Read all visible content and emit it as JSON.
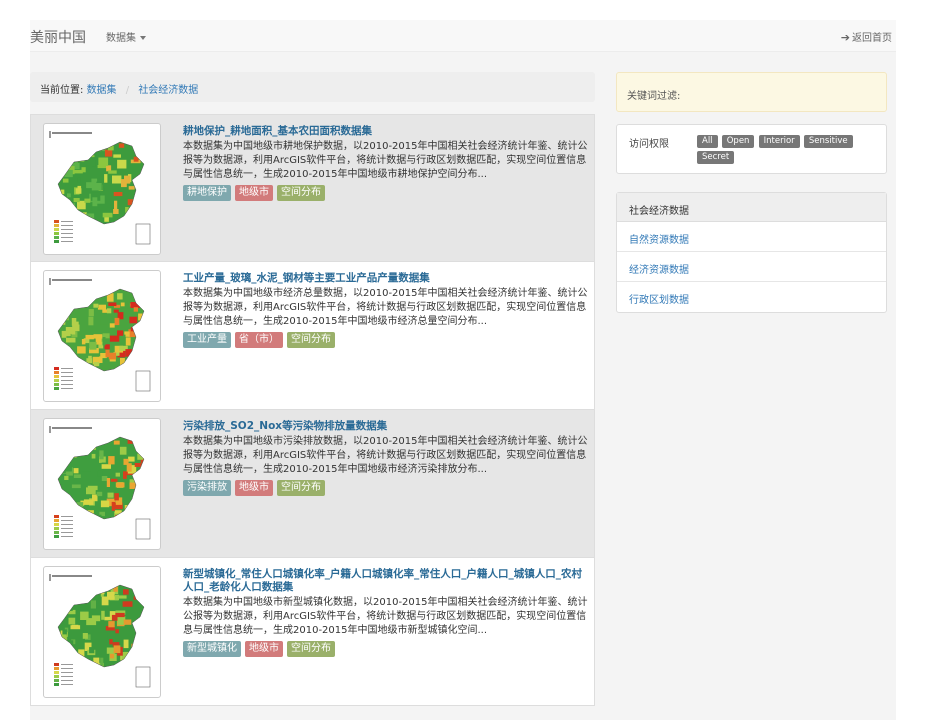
{
  "navbar": {
    "brand": "美丽中国",
    "dropdown_label": "数据集",
    "home_label": "返回首页"
  },
  "breadcrumb": {
    "prefix": "当前位置:",
    "items": [
      "数据集",
      "社会经济数据"
    ]
  },
  "datasets": [
    {
      "title": "耕地保护_耕地面积_基本农田面积数据集",
      "description": "本数据集为中国地级市耕地保护数据，以2010-2015年中国相关社会经济统计年鉴、统计公报等为数据源，利用ArcGIS软件平台，将统计数据与行政区划数据匹配，实现空间位置信息与属性信息统一，生成2010-2015年中国地级市耕地保护空间分布...",
      "tags": [
        "耕地保护",
        "地级市",
        "空间分布"
      ]
    },
    {
      "title": "工业产量_玻璃_水泥_钢材等主要工业产品产量数据集",
      "description": "本数据集为中国地级市经济总量数据，以2010-2015年中国相关社会经济统计年鉴、统计公报等为数据源，利用ArcGIS软件平台，将统计数据与行政区划数据匹配，实现空间位置信息与属性信息统一，生成2010-2015年中国地级市经济总量空间分布...",
      "tags": [
        "工业产量",
        "省（市）",
        "空间分布"
      ]
    },
    {
      "title": "污染排放_SO2_Nox等污染物排放量数据集",
      "description": "本数据集为中国地级市污染排放数据，以2010-2015年中国相关社会经济统计年鉴、统计公报等为数据源，利用ArcGIS软件平台，将统计数据与行政区划数据匹配，实现空间位置信息与属性信息统一，生成2010-2015年中国地级市经济污染排放分布...",
      "tags": [
        "污染排放",
        "地级市",
        "空间分布"
      ]
    },
    {
      "title": "新型城镇化_常住人口城镇化率_户籍人口城镇化率_常住人口_户籍人口_城镇人口_农村人口_老龄化人口数据集",
      "description": "本数据集为中国地级市新型城镇化数据，以2010-2015年中国相关社会经济统计年鉴、统计公报等为数据源，利用ArcGIS软件平台，将统计数据与行政区划数据匹配，实现空间位置信息与属性信息统一，生成2010-2015年中国地级市新型城镇化空间...",
      "tags": [
        "新型城镇化",
        "地级市",
        "空间分布"
      ]
    }
  ],
  "sidebar": {
    "filter_label": "关键词过滤:",
    "access_label": "访问权限",
    "access_levels": [
      "All",
      "Open",
      "Interior",
      "Sensitive",
      "Secret"
    ],
    "category_header": "社会经济数据",
    "categories": [
      "自然资源数据",
      "经济资源数据",
      "行政区划数据"
    ]
  },
  "colors": {
    "link": "#337ab7",
    "title": "#2a6a96",
    "tag_blue": "#7fa8ae",
    "tag_red": "#d27b7b",
    "tag_green": "#9ab06a",
    "filter_bg": "#fcf8e3"
  },
  "icons": {
    "home": "arrow-right-icon",
    "dropdown": "caret-down-icon"
  }
}
